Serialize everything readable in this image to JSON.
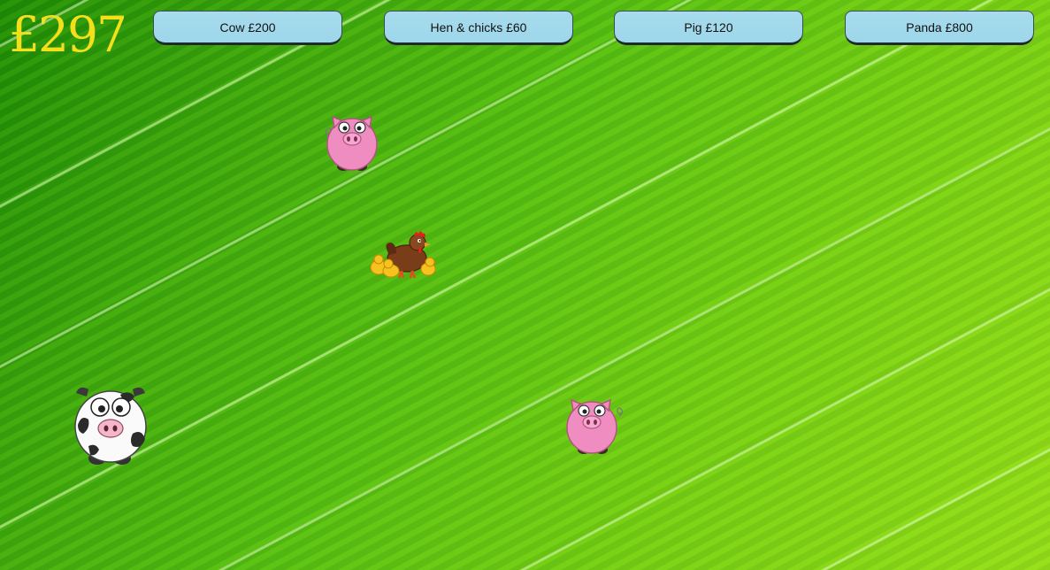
{
  "hud": {
    "money": "£297"
  },
  "shop": {
    "buttons": [
      {
        "label": "Cow £200"
      },
      {
        "label": "Hen & chicks £60"
      },
      {
        "label": "Pig £120"
      },
      {
        "label": "Panda £800"
      }
    ]
  },
  "animals": [
    {
      "kind": "pig",
      "icon": "pig-icon"
    },
    {
      "kind": "hen-and-chicks",
      "icon": "hen-with-chicks-icon"
    },
    {
      "kind": "cow",
      "icon": "cow-icon"
    },
    {
      "kind": "pig",
      "icon": "pig-icon"
    }
  ],
  "colors": {
    "money": "#f4e01a",
    "button": "#9ed6ea",
    "grass": "#49b50f"
  }
}
